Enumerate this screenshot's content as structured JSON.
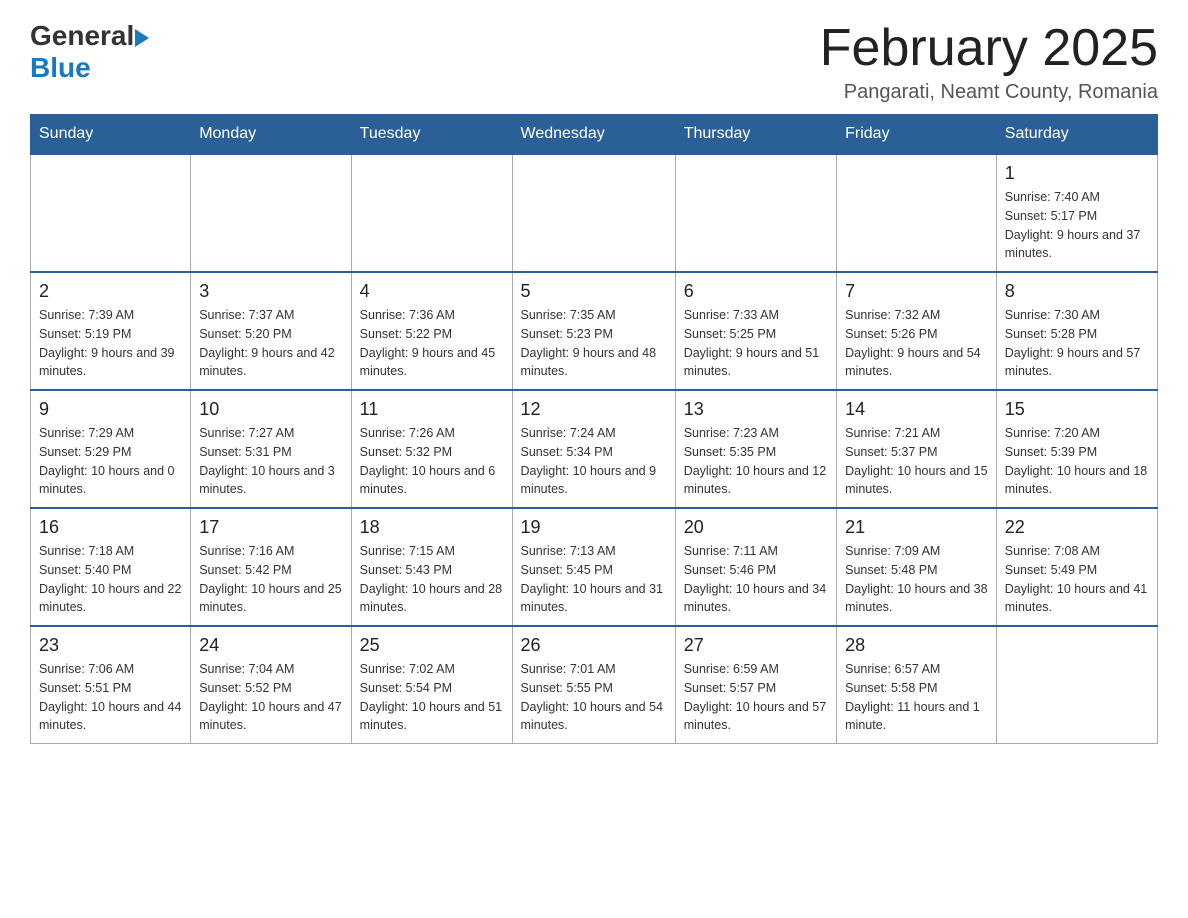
{
  "header": {
    "logo": {
      "general": "General",
      "blue": "Blue",
      "tagline": ""
    },
    "title": "February 2025",
    "location": "Pangarati, Neamt County, Romania"
  },
  "weekdays": [
    "Sunday",
    "Monday",
    "Tuesday",
    "Wednesday",
    "Thursday",
    "Friday",
    "Saturday"
  ],
  "weeks": [
    [
      {
        "day": "",
        "info": ""
      },
      {
        "day": "",
        "info": ""
      },
      {
        "day": "",
        "info": ""
      },
      {
        "day": "",
        "info": ""
      },
      {
        "day": "",
        "info": ""
      },
      {
        "day": "",
        "info": ""
      },
      {
        "day": "1",
        "info": "Sunrise: 7:40 AM\nSunset: 5:17 PM\nDaylight: 9 hours and 37 minutes."
      }
    ],
    [
      {
        "day": "2",
        "info": "Sunrise: 7:39 AM\nSunset: 5:19 PM\nDaylight: 9 hours and 39 minutes."
      },
      {
        "day": "3",
        "info": "Sunrise: 7:37 AM\nSunset: 5:20 PM\nDaylight: 9 hours and 42 minutes."
      },
      {
        "day": "4",
        "info": "Sunrise: 7:36 AM\nSunset: 5:22 PM\nDaylight: 9 hours and 45 minutes."
      },
      {
        "day": "5",
        "info": "Sunrise: 7:35 AM\nSunset: 5:23 PM\nDaylight: 9 hours and 48 minutes."
      },
      {
        "day": "6",
        "info": "Sunrise: 7:33 AM\nSunset: 5:25 PM\nDaylight: 9 hours and 51 minutes."
      },
      {
        "day": "7",
        "info": "Sunrise: 7:32 AM\nSunset: 5:26 PM\nDaylight: 9 hours and 54 minutes."
      },
      {
        "day": "8",
        "info": "Sunrise: 7:30 AM\nSunset: 5:28 PM\nDaylight: 9 hours and 57 minutes."
      }
    ],
    [
      {
        "day": "9",
        "info": "Sunrise: 7:29 AM\nSunset: 5:29 PM\nDaylight: 10 hours and 0 minutes."
      },
      {
        "day": "10",
        "info": "Sunrise: 7:27 AM\nSunset: 5:31 PM\nDaylight: 10 hours and 3 minutes."
      },
      {
        "day": "11",
        "info": "Sunrise: 7:26 AM\nSunset: 5:32 PM\nDaylight: 10 hours and 6 minutes."
      },
      {
        "day": "12",
        "info": "Sunrise: 7:24 AM\nSunset: 5:34 PM\nDaylight: 10 hours and 9 minutes."
      },
      {
        "day": "13",
        "info": "Sunrise: 7:23 AM\nSunset: 5:35 PM\nDaylight: 10 hours and 12 minutes."
      },
      {
        "day": "14",
        "info": "Sunrise: 7:21 AM\nSunset: 5:37 PM\nDaylight: 10 hours and 15 minutes."
      },
      {
        "day": "15",
        "info": "Sunrise: 7:20 AM\nSunset: 5:39 PM\nDaylight: 10 hours and 18 minutes."
      }
    ],
    [
      {
        "day": "16",
        "info": "Sunrise: 7:18 AM\nSunset: 5:40 PM\nDaylight: 10 hours and 22 minutes."
      },
      {
        "day": "17",
        "info": "Sunrise: 7:16 AM\nSunset: 5:42 PM\nDaylight: 10 hours and 25 minutes."
      },
      {
        "day": "18",
        "info": "Sunrise: 7:15 AM\nSunset: 5:43 PM\nDaylight: 10 hours and 28 minutes."
      },
      {
        "day": "19",
        "info": "Sunrise: 7:13 AM\nSunset: 5:45 PM\nDaylight: 10 hours and 31 minutes."
      },
      {
        "day": "20",
        "info": "Sunrise: 7:11 AM\nSunset: 5:46 PM\nDaylight: 10 hours and 34 minutes."
      },
      {
        "day": "21",
        "info": "Sunrise: 7:09 AM\nSunset: 5:48 PM\nDaylight: 10 hours and 38 minutes."
      },
      {
        "day": "22",
        "info": "Sunrise: 7:08 AM\nSunset: 5:49 PM\nDaylight: 10 hours and 41 minutes."
      }
    ],
    [
      {
        "day": "23",
        "info": "Sunrise: 7:06 AM\nSunset: 5:51 PM\nDaylight: 10 hours and 44 minutes."
      },
      {
        "day": "24",
        "info": "Sunrise: 7:04 AM\nSunset: 5:52 PM\nDaylight: 10 hours and 47 minutes."
      },
      {
        "day": "25",
        "info": "Sunrise: 7:02 AM\nSunset: 5:54 PM\nDaylight: 10 hours and 51 minutes."
      },
      {
        "day": "26",
        "info": "Sunrise: 7:01 AM\nSunset: 5:55 PM\nDaylight: 10 hours and 54 minutes."
      },
      {
        "day": "27",
        "info": "Sunrise: 6:59 AM\nSunset: 5:57 PM\nDaylight: 10 hours and 57 minutes."
      },
      {
        "day": "28",
        "info": "Sunrise: 6:57 AM\nSunset: 5:58 PM\nDaylight: 11 hours and 1 minute."
      },
      {
        "day": "",
        "info": ""
      }
    ]
  ]
}
